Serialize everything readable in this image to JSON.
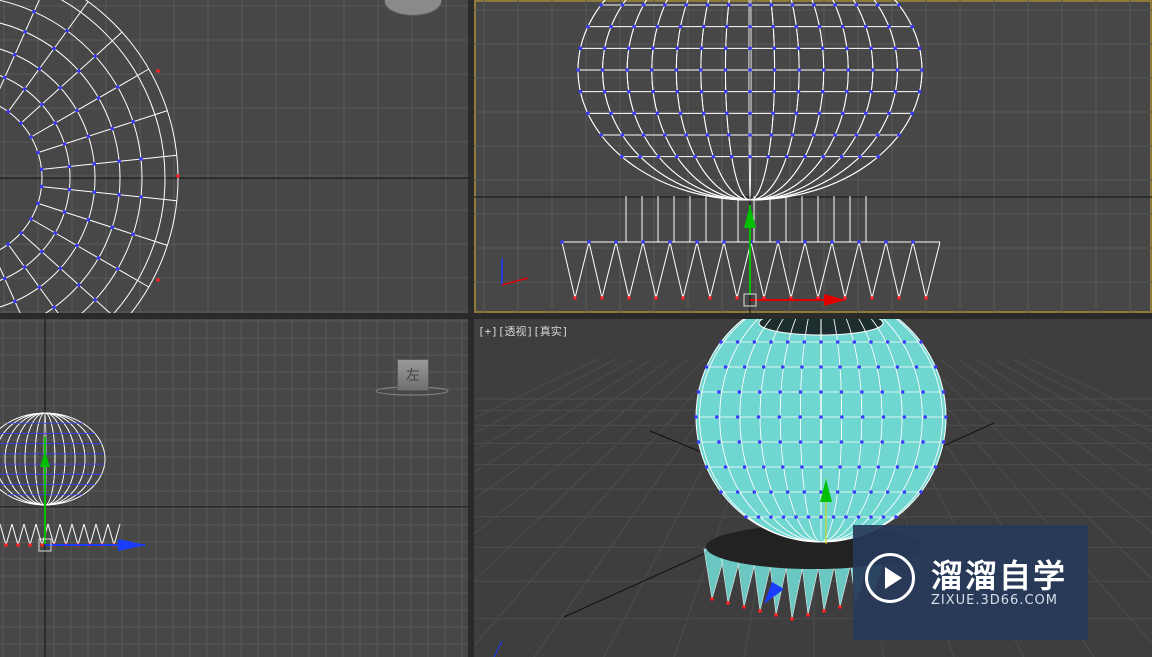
{
  "viewports": {
    "top": {
      "name": "top"
    },
    "front": {
      "name": "front"
    },
    "left": {
      "name": "left",
      "viewcube_label": "左"
    },
    "perspective": {
      "label_plus": "[+]",
      "label_view": "[透视]",
      "label_shading": "[真实]"
    }
  },
  "watermark": {
    "brand": "溜溜自学",
    "url": "ZIXUE.3D66.COM"
  },
  "colors": {
    "viewport_bg": "#474747",
    "grid": "#5a5a5a",
    "wire": "#ffffff",
    "vertex": "#3a3aff",
    "selected_vertex": "#ff2020",
    "active_border": "#8e7a3a",
    "mesh_fill": "#6fd6d0",
    "axis_y": "#00c000",
    "axis_x": "#e00000",
    "axis_z": "#1a3cff"
  },
  "icons": [
    "viewcube-icon",
    "gizmo-icon",
    "play-icon"
  ]
}
